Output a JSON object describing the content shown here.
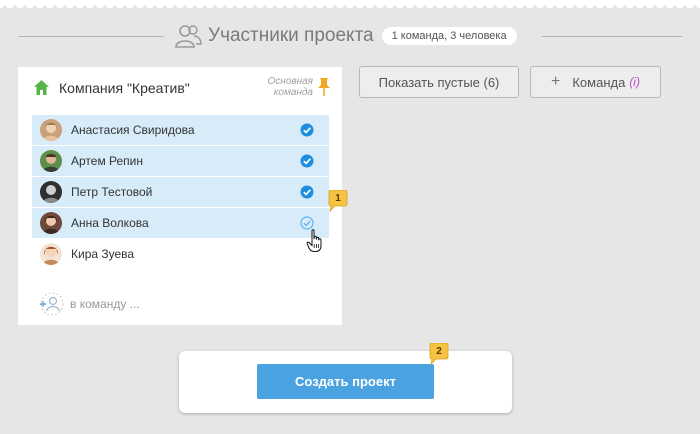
{
  "header": {
    "title": "Участники проекта",
    "summary_badge": "1 команда, 3 человека",
    "icon": "users-icon"
  },
  "team": {
    "name": "Компания \"Креатив\"",
    "main_label": "Основная команда",
    "members": [
      {
        "name": "Анастасия Свиридова",
        "selected": true
      },
      {
        "name": "Артем Репин",
        "selected": true
      },
      {
        "name": "Петр Тестовой",
        "selected": true
      },
      {
        "name": "Анна Волкова",
        "selected": true
      },
      {
        "name": "Кира Зуева",
        "selected": false
      }
    ],
    "add_placeholder": "в команду ..."
  },
  "toolbar": {
    "show_empty_label": "Показать пустые (6)",
    "add_team_label": "Команда",
    "add_team_info": "(i)"
  },
  "hints": [
    "1",
    "2"
  ],
  "footer": {
    "create_label": "Создать проект"
  },
  "colors": {
    "accent": "#4aa3e0",
    "selected_row": "#d7ebf9",
    "check": "#1e8fe0",
    "home": "#57b447",
    "pin": "#f5a623",
    "hint": "#f5c242"
  }
}
